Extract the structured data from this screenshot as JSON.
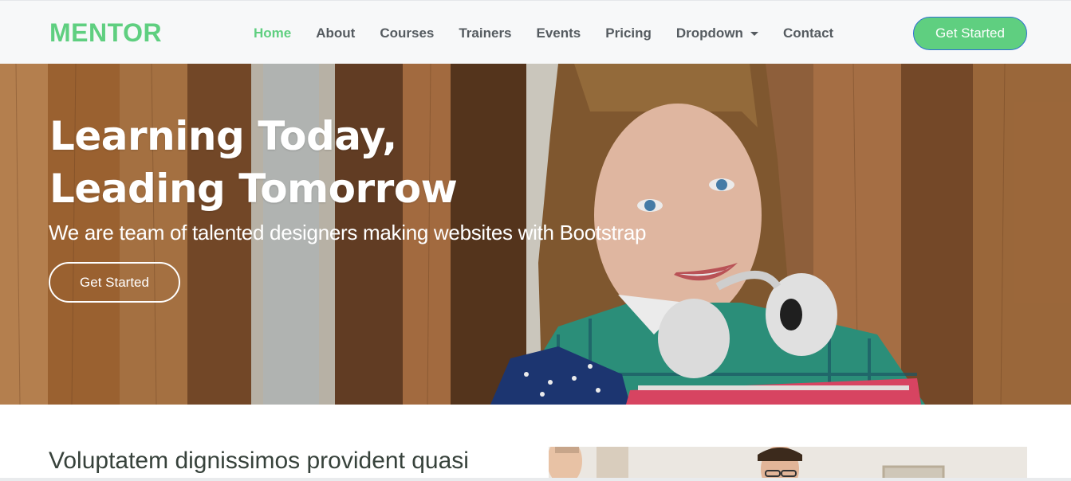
{
  "brand": {
    "logo": "MENTOR",
    "accent_color": "#5fcf80"
  },
  "nav": {
    "items": [
      {
        "label": "Home",
        "active": true
      },
      {
        "label": "About",
        "active": false
      },
      {
        "label": "Courses",
        "active": false
      },
      {
        "label": "Trainers",
        "active": false
      },
      {
        "label": "Events",
        "active": false
      },
      {
        "label": "Pricing",
        "active": false
      },
      {
        "label": "Dropdown",
        "active": false,
        "has_dropdown": true,
        "icon": "chevron-down-icon"
      },
      {
        "label": "Contact",
        "active": false
      }
    ],
    "cta_label": "Get Started"
  },
  "hero": {
    "title_line1": "Learning Today,",
    "title_line2": "Leading Tomorrow",
    "subtitle": "We are team of talented designers making websites with Bootstrap",
    "cta_label": "Get Started",
    "image": "student-girl-with-headphones-photo"
  },
  "about": {
    "title": "Voluptatem dignissimos provident quasi",
    "image": "people-in-office-photo"
  }
}
